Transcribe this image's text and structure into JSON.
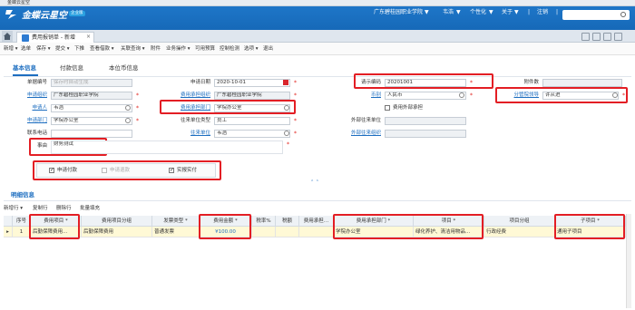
{
  "window": {
    "title": "金蝶云星空"
  },
  "header": {
    "brand": "金蝶云星空",
    "brand_tag": "企业版",
    "org": "广东碧桂园职业学院",
    "user": "韦浩",
    "personalize": "个性化",
    "about": "关于",
    "logout": "注销",
    "org_arrow": "▼",
    "user_arrow": "▼",
    "personalize_arrow": "▼",
    "about_arrow": "▼",
    "search_icon": "search-icon",
    "sep": "|"
  },
  "tabs": {
    "home_icon": "home-icon",
    "active_tab": "费用报销单 - 新增",
    "close": "×"
  },
  "toolbar": {
    "items": [
      "新增 ▾",
      "选单",
      "保存 ▾",
      "提交 ▾",
      "下推",
      "查看借款 ▾",
      "关联查询 ▾",
      "附件",
      "业务操作 ▾",
      "可用预算",
      "控制检测",
      "选项 ▾",
      "退出"
    ]
  },
  "subtabs": {
    "basic": "基本信息",
    "payment": "付款信息",
    "currency": "本位币信息"
  },
  "form": {
    "doc_no_label": "单据编号",
    "doc_no_placeholder": "保存时自动生成",
    "apply_org_label": "申请组织",
    "apply_org": "广东碧桂园职业学院",
    "applicant_label": "申请人",
    "applicant": "韦浩",
    "apply_dept_label": "申请部门",
    "apply_dept": "学院办公室",
    "phone_label": "联系电话",
    "phone": "",
    "reason_label": "事由",
    "reason": "财务测试",
    "apply_date_label": "申请日期",
    "apply_date": "2020-10-01",
    "cost_org_label": "费用承担组织",
    "cost_org": "广东碧桂园职业学院",
    "cost_dept_label": "费用承担部门",
    "cost_dept": "学院办公室",
    "contact_type_label": "往来单位类型",
    "contact_type": "员工",
    "contact_unit_label": "往来单位",
    "contact_unit": "韦浩",
    "request_no_label": "请示编码",
    "request_no": "20201001",
    "currency_label": "币别",
    "currency": "人民币",
    "external_label": "费用外部承担",
    "ext_dept_label": "外部往来单位",
    "ext_org_label": "外部往来组织",
    "attach_label": "附件数",
    "attach": "",
    "leader_label": "分管院领导",
    "leader": "许从进",
    "cb_pay": "申请付款",
    "cb_refund": "申请退款",
    "cb_actual": "实报实付",
    "required": "*",
    "splitter": "⌃ ⌃"
  },
  "detail": {
    "title": "明细信息",
    "toolbar": [
      "新增行 ▾",
      "复制行",
      "删除行",
      "批量填充"
    ],
    "columns": [
      "序号",
      "费用项目 *",
      "费用项目分组",
      "发票类型 *",
      "费用金额 *",
      "税率%",
      "税额",
      "费用承担…",
      "费用承担部门 *",
      "项目 *",
      "项目分组",
      "子项目 *"
    ],
    "rows": [
      {
        "marker": "▸",
        "no": "1",
        "item": "后勤保障费用...",
        "group": "后勤保障费用",
        "invoice": "普通发票",
        "amount": "¥100.00",
        "tax_rate": "",
        "tax": "",
        "cost_bearer": "",
        "cost_dept": "学院办公室",
        "project": "绿化养护、清洁用物品...",
        "project_group": "行政经费",
        "sub_project": "通用子项目"
      }
    ]
  }
}
